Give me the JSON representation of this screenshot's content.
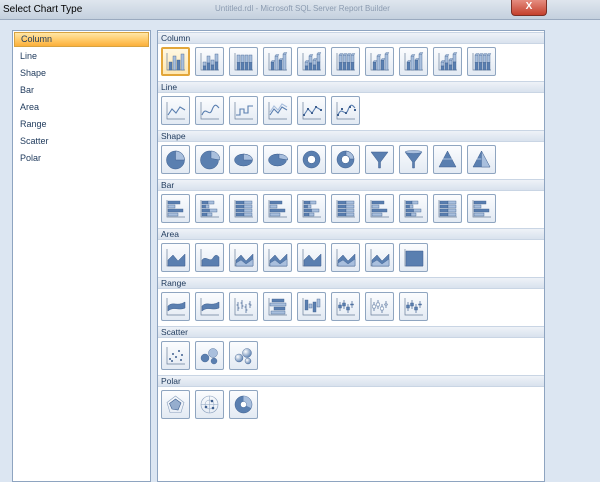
{
  "dialog": {
    "title": "Select Chart Type",
    "window_title": "Untitled.rdl - Microsoft SQL Server Report Builder",
    "close_label": "X"
  },
  "colors": {
    "icon_blue": "#5a7fb0",
    "icon_light": "#a9bfdd",
    "selected_orange": "#ffc661",
    "header_bg": "#dce6f2"
  },
  "categories": [
    {
      "label": "Column",
      "selected": true
    },
    {
      "label": "Line"
    },
    {
      "label": "Shape"
    },
    {
      "label": "Bar"
    },
    {
      "label": "Area"
    },
    {
      "label": "Range"
    },
    {
      "label": "Scatter"
    },
    {
      "label": "Polar"
    }
  ],
  "sections": [
    {
      "title": "Column",
      "icons": [
        "column",
        "stacked-column",
        "100-stacked-column",
        "3d-clustered-column",
        "3d-stacked-column",
        "3d-100-stacked-column",
        "3d-column",
        "3d-cylinder-column",
        "3d-stacked-cylinder-column",
        "3d-100-stacked-cylinder-column"
      ]
    },
    {
      "title": "Line",
      "icons": [
        "line",
        "smooth-line",
        "stepped-line",
        "3d-line",
        "line-with-markers",
        "smooth-line-with-markers"
      ]
    },
    {
      "title": "Shape",
      "icons": [
        "pie",
        "exploded-pie",
        "3d-pie",
        "3d-exploded-pie",
        "doughnut",
        "exploded-doughnut",
        "funnel",
        "3d-funnel",
        "pyramid",
        "3d-pyramid"
      ]
    },
    {
      "title": "Bar",
      "icons": [
        "bar",
        "stacked-bar",
        "100-stacked-bar",
        "3d-clustered-bar",
        "3d-stacked-bar",
        "3d-100-stacked-bar",
        "3d-cylinder-bar",
        "3d-stacked-cylinder-bar",
        "3d-100-stacked-cylinder-bar",
        "3d-bar"
      ]
    },
    {
      "title": "Area",
      "icons": [
        "area",
        "smooth-area",
        "stacked-area",
        "100-stacked-area",
        "3d-area",
        "3d-stacked-area",
        "3d-100-stacked-area",
        "3d-full-area"
      ]
    },
    {
      "title": "Range",
      "icons": [
        "range",
        "smooth-range",
        "stock",
        "range-bar",
        "range-column",
        "candlestick",
        "error-bar",
        "box-plot"
      ]
    },
    {
      "title": "Scatter",
      "icons": [
        "scatter",
        "bubble",
        "3d-bubble"
      ]
    },
    {
      "title": "Polar",
      "icons": [
        "radar",
        "polar",
        "3d-polar"
      ]
    }
  ]
}
